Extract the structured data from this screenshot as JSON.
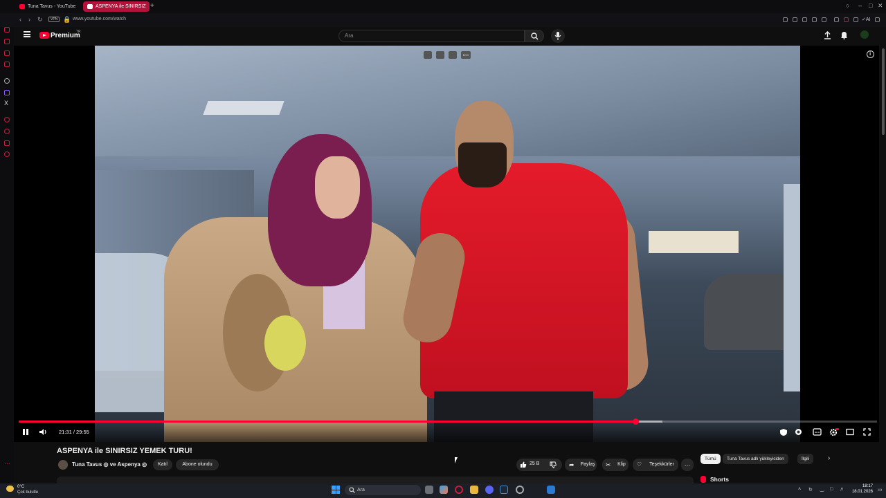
{
  "browser": {
    "tabs": [
      {
        "label": "Tuna Tavus - YouTube",
        "active": false
      },
      {
        "label": "ASPENYA ile SINIRSIZ",
        "active": true
      }
    ],
    "new_tab_glyph": "+",
    "url": "www.youtube.com/watch",
    "vpn_badge": "VPN",
    "accent": "#b3123a"
  },
  "youtube": {
    "brand": "Premium",
    "brand_sup": "TR",
    "search_placeholder": "Ara",
    "icons": [
      "menu-icon",
      "search-icon",
      "mic-icon",
      "upload-icon",
      "bell-icon",
      "avatar"
    ]
  },
  "player": {
    "time_current": "21:31",
    "time_total": "29:55",
    "time_display": "21:31 / 29:55",
    "progress_fraction": 0.719,
    "buffered_fraction": 0.75,
    "overlay_badge": "BGX",
    "accent": "#ff0033"
  },
  "video": {
    "title": "ASPENYA ile SINIRSIZ YEMEK TURU!",
    "channel": "Tuna Tavus ◎ ve Aspenya ◎",
    "join_label": "Katıl",
    "subscribed_label": "Abone olundu",
    "like_count": "25 B",
    "share_label": "Paylaş",
    "clip_label": "Klip",
    "thanks_label": "Teşekkürler",
    "more_label": "…"
  },
  "sidebar_right": {
    "chips": [
      "Tümü",
      "Tuna Tavus adlı yükleyiciden",
      "İlgili"
    ],
    "shorts_label": "Shorts"
  },
  "taskbar": {
    "weather_temp": "0°C",
    "weather_desc": "Çok bulutlu",
    "search_placeholder": "Ara",
    "time": "18:17",
    "date": "18.01.2026"
  }
}
